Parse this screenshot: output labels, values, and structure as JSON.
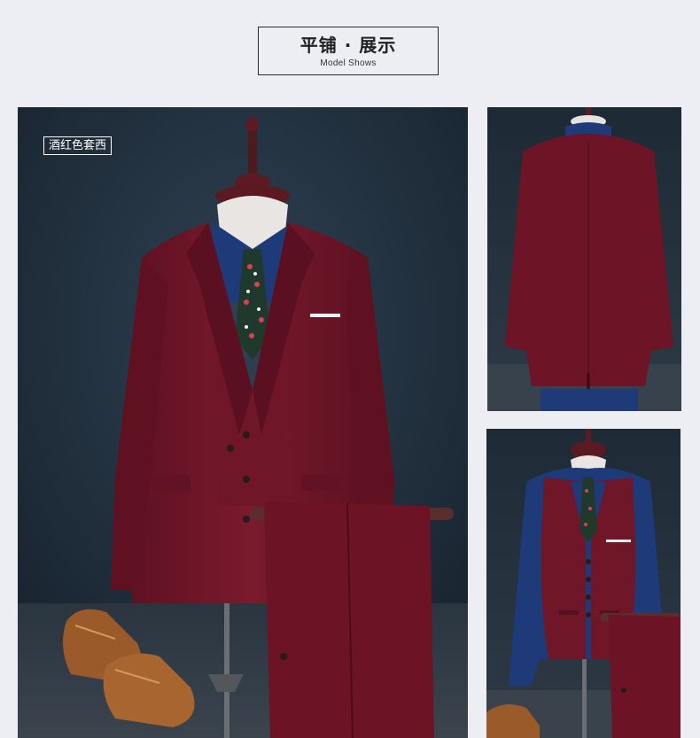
{
  "header": {
    "title": "平铺 · 展示",
    "subtitle": "Model Shows"
  },
  "main_photo": {
    "label": "酒红色套西"
  },
  "colors": {
    "suit": "#6b1526",
    "backdrop": "#233240",
    "shirt": "#1f3a78",
    "shoe": "#9b5a2a"
  }
}
